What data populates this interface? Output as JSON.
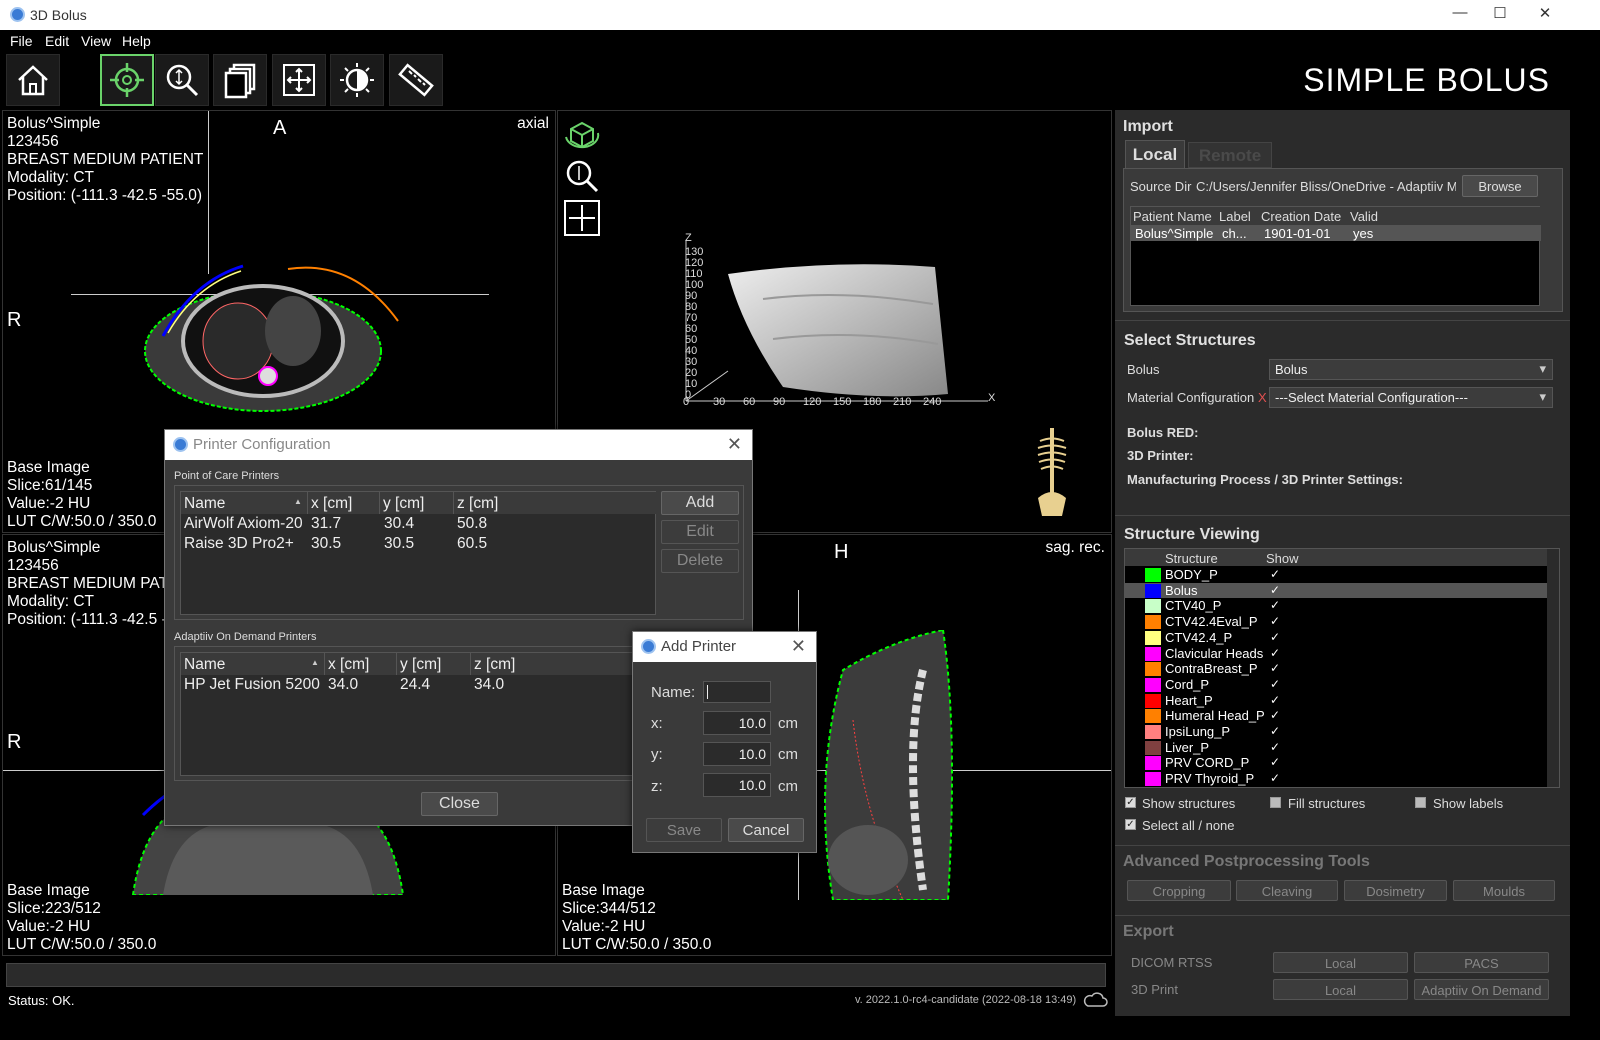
{
  "window": {
    "title": "3D Bolus",
    "minimize": "—",
    "maximize": "☐",
    "close": "✕"
  },
  "menu": [
    "File",
    "Edit",
    "View",
    "Help"
  ],
  "app_name": "SIMPLE BOLUS",
  "viewports": {
    "axial": {
      "patient": "Bolus^Simple",
      "id": "123456",
      "desc": "BREAST MEDIUM PATIENT",
      "modality": "Modality: CT",
      "position": "Position: (-111.3 -42.5 -55.0)",
      "orientation": "axial",
      "top": "A",
      "left": "R",
      "base": "Base Image",
      "slice": "Slice:61/145",
      "value": "Value:-2 HU",
      "lut": "LUT C/W:50.0 / 350.0"
    },
    "coronal": {
      "patient": "Bolus^Simple",
      "id": "123456",
      "desc": "BREAST MEDIUM PATIENT",
      "modality": "Modality: CT",
      "position": "Position: (-111.3 -42.5 -",
      "left": "R",
      "base": "Base Image",
      "slice": "Slice:223/512",
      "value": "Value:-2 HU",
      "lut": "LUT C/W:50.0 / 350.0"
    },
    "sagittal": {
      "orientation": "sag. rec.",
      "top": "H",
      "base": "Base Image",
      "slice": "Slice:344/512",
      "value": "Value:-2 HU",
      "lut": "LUT C/W:50.0 / 350.0"
    },
    "render3d": {
      "z_label": "Z",
      "x_label": "X",
      "z_ticks": [
        "130",
        "120",
        "110",
        "100",
        "90",
        "80",
        "70",
        "60",
        "50",
        "40",
        "30",
        "20",
        "10",
        "0"
      ],
      "x_ticks": [
        "0",
        "30",
        "60",
        "90",
        "120",
        "150",
        "180",
        "210",
        "240"
      ]
    }
  },
  "import": {
    "title": "Import",
    "tabs": [
      "Local",
      "Remote"
    ],
    "source_label": "Source Dir",
    "source_value": "C:/Users/Jennifer Bliss/OneDrive - Adaptiiv Me",
    "browse": "Browse",
    "columns": [
      "Patient Name",
      "Label",
      "Creation Date",
      "Valid"
    ],
    "rows": [
      [
        "Bolus^Simple",
        "ch...",
        "1901-01-01",
        "yes"
      ]
    ]
  },
  "select_structures": {
    "title": "Select Structures",
    "bolus_label": "Bolus",
    "bolus_value": "Bolus",
    "material_label": "Material Configuration",
    "material_x": "X",
    "material_value": "---Select Material Configuration---",
    "bolus_red": "Bolus RED:",
    "printer": "3D Printer:",
    "manufacturing": "Manufacturing Process / 3D Printer Settings:"
  },
  "structure_viewing": {
    "title": "Structure Viewing",
    "col_structure": "Structure",
    "col_show": "Show",
    "items": [
      {
        "name": "BODY_P",
        "color": "#00ff00",
        "show": "✓"
      },
      {
        "name": "Bolus",
        "color": "#0000ff",
        "show": "✓"
      },
      {
        "name": "CTV40_P",
        "color": "#c8ffc8",
        "show": "✓"
      },
      {
        "name": "CTV42.4Eval_P",
        "color": "#ff8000",
        "show": "✓"
      },
      {
        "name": "CTV42.4_P",
        "color": "#ffff80",
        "show": "✓"
      },
      {
        "name": "Clavicular Heads",
        "color": "#ff00ff",
        "show": "✓"
      },
      {
        "name": "ContraBreast_P",
        "color": "#ff8000",
        "show": "✓"
      },
      {
        "name": "Cord_P",
        "color": "#ff00ff",
        "show": "✓"
      },
      {
        "name": "Heart_P",
        "color": "#ff0000",
        "show": "✓"
      },
      {
        "name": "Humeral Head_P",
        "color": "#ff8000",
        "show": "✓"
      },
      {
        "name": "IpsiLung_P",
        "color": "#ff8080",
        "show": "✓"
      },
      {
        "name": "Liver_P",
        "color": "#804040",
        "show": "✓"
      },
      {
        "name": "PRV CORD_P",
        "color": "#ff00ff",
        "show": "✓"
      },
      {
        "name": "PRV Thyroid_P",
        "color": "#ff00ff",
        "show": "✓"
      }
    ],
    "show_structures": "Show structures",
    "fill_structures": "Fill structures",
    "show_labels": "Show labels",
    "select_all": "Select all / none"
  },
  "advanced": {
    "title": "Advanced Postprocessing Tools",
    "buttons": [
      "Cropping",
      "Cleaving",
      "Dosimetry",
      "Moulds"
    ]
  },
  "export": {
    "title": "Export",
    "dicom_label": "DICOM RTSS",
    "print_label": "3D Print",
    "dicom_buttons": [
      "Local",
      "PACS"
    ],
    "print_buttons": [
      "Local",
      "Adaptiiv On Demand"
    ]
  },
  "status": {
    "text": "Status: OK.",
    "version": "v. 2022.1.0-rc4-candidate (2022-08-18 13:49)"
  },
  "printer_config": {
    "title": "Printer Configuration",
    "poc_label": "Point of Care Printers",
    "columns": [
      "Name",
      "x [cm]",
      "y [cm]",
      "z [cm]"
    ],
    "poc_rows": [
      [
        "AirWolf Axiom-20",
        "31.7",
        "30.4",
        "50.8"
      ],
      [
        "Raise 3D Pro2+",
        "30.5",
        "30.5",
        "60.5"
      ]
    ],
    "aod_label": "Adaptiiv On Demand Printers",
    "aod_rows": [
      [
        "HP Jet Fusion 5200",
        "34.0",
        "24.4",
        "34.0"
      ]
    ],
    "add": "Add",
    "edit": "Edit",
    "delete": "Delete",
    "close": "Close"
  },
  "add_printer": {
    "title": "Add Printer",
    "name_label": "Name:",
    "name_value": "",
    "x_label": "x:",
    "y_label": "y:",
    "z_label": "z:",
    "x_value": "10.0",
    "y_value": "10.0",
    "z_value": "10.0",
    "unit": "cm",
    "save": "Save",
    "cancel": "Cancel"
  }
}
